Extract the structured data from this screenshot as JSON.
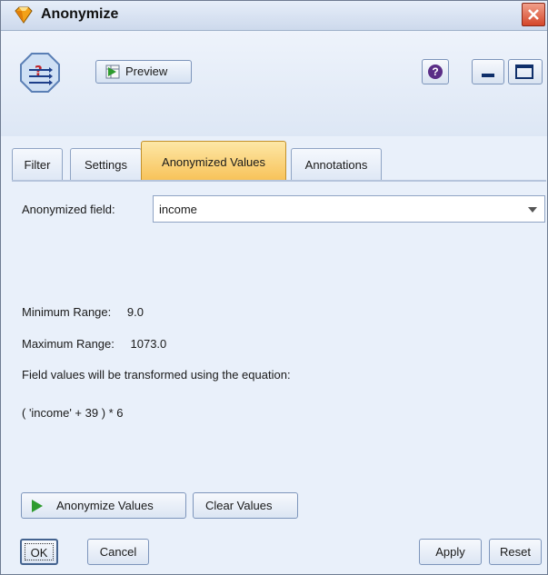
{
  "window": {
    "title": "Anonymize"
  },
  "toolbar": {
    "preview_label": "Preview"
  },
  "tabs": [
    {
      "label": "Filter"
    },
    {
      "label": "Settings"
    },
    {
      "label": "Anonymized Values"
    },
    {
      "label": "Annotations"
    }
  ],
  "anonymized_field": {
    "label": "Anonymized field:",
    "value": "income"
  },
  "ranges": {
    "minimum_label": "Minimum Range:",
    "minimum_value": "9.0",
    "maximum_label": "Maximum Range:",
    "maximum_value": "1073.0"
  },
  "equation": {
    "description": "Field values will be transformed using the equation:",
    "text": "( 'income' + 39 ) * 6"
  },
  "buttons": {
    "anonymize_values": "Anonymize Values",
    "clear_values": "Clear Values",
    "ok": "OK",
    "cancel": "Cancel",
    "apply": "Apply",
    "reset": "Reset"
  },
  "colors": {
    "active_tab": "#f8c35a",
    "window_bg": "#e9f0fa",
    "close_button": "#d4462a"
  }
}
